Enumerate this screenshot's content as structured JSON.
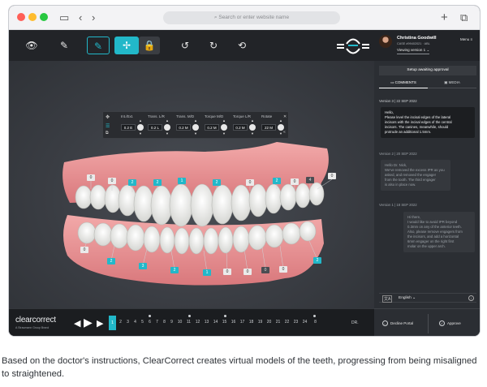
{
  "browser": {
    "url_placeholder": "Search or enter website name"
  },
  "doctor": {
    "name": "Christina Goodwill",
    "case": "CASE #99402021 · ABL",
    "version_selector": "Viewing version 1",
    "menu_label": "Menu"
  },
  "movement_table": {
    "headers": [
      "Int./Ext.",
      "Trans. L/R",
      "Trans. M/D",
      "Torque M/D",
      "Torque L/R",
      "Rotate"
    ],
    "values": [
      "0.2 E",
      "0.2 L",
      "0.2 M",
      "0.2 M",
      "0.2 M",
      "22 M"
    ]
  },
  "tooth_tags": {
    "upper": [
      "0",
      "0",
      "2",
      "2",
      "1",
      "2",
      "0",
      "2",
      "0",
      "4",
      "0"
    ],
    "lower": [
      "0",
      "2",
      "3",
      "2",
      "1",
      "0",
      "0",
      "0",
      "0",
      "2"
    ]
  },
  "right_panel": {
    "setup_status": "Setup awaiting approval",
    "tabs": [
      "COMMENTS",
      "MEDIA"
    ],
    "messages": [
      {
        "header": "Version 3  |  22 SEP 2022",
        "lines": [
          "Hello,",
          "Please level the incisal edges of the lateral",
          "incisors with the incisal edges of the central",
          "incisors. The canines, meanwhile, should",
          "protrude an additional 1.5mm."
        ]
      },
      {
        "header": "Version 2  |  20 SEP 2022",
        "lines": [
          "Hello Dr. Nick,",
          "We've removed the excess IPR as you",
          "asked, and removed the engager",
          "from the tooth. The third engager",
          "is also in place now."
        ]
      },
      {
        "header": "Version 1  |  18 SEP 2022",
        "lines": [
          "Hi there,",
          "I would like to avoid IPR beyond",
          "0.3mm on any of the anterior teeth.",
          "Also, please remove engagers from",
          "the incisors, and add a horizontal",
          "6mm engager on the right first",
          "molar on the upper arch."
        ]
      }
    ],
    "language": "English",
    "decline_label": "Decline Portal",
    "approve_label": "Approve"
  },
  "timeline": {
    "logo": "clearcorrect",
    "logo_sub": "A Straumann Group Brand",
    "steps": [
      "1",
      "2",
      "3",
      "4",
      "5",
      "6",
      "7",
      "8",
      "9",
      "10",
      "11",
      "12",
      "13",
      "14",
      "15",
      "16",
      "17",
      "18",
      "19",
      "20",
      "21",
      "22",
      "23",
      "24",
      "8"
    ],
    "selected_step": "1",
    "end_label": "DR."
  },
  "caption": "Based on the doctor's instructions, ClearCorrect creates virtual models of the teeth, progressing from being misaligned to straightened.",
  "colors": {
    "accent": "#22b8c9",
    "gum": "#e58c8f",
    "background": "#1e2023"
  }
}
